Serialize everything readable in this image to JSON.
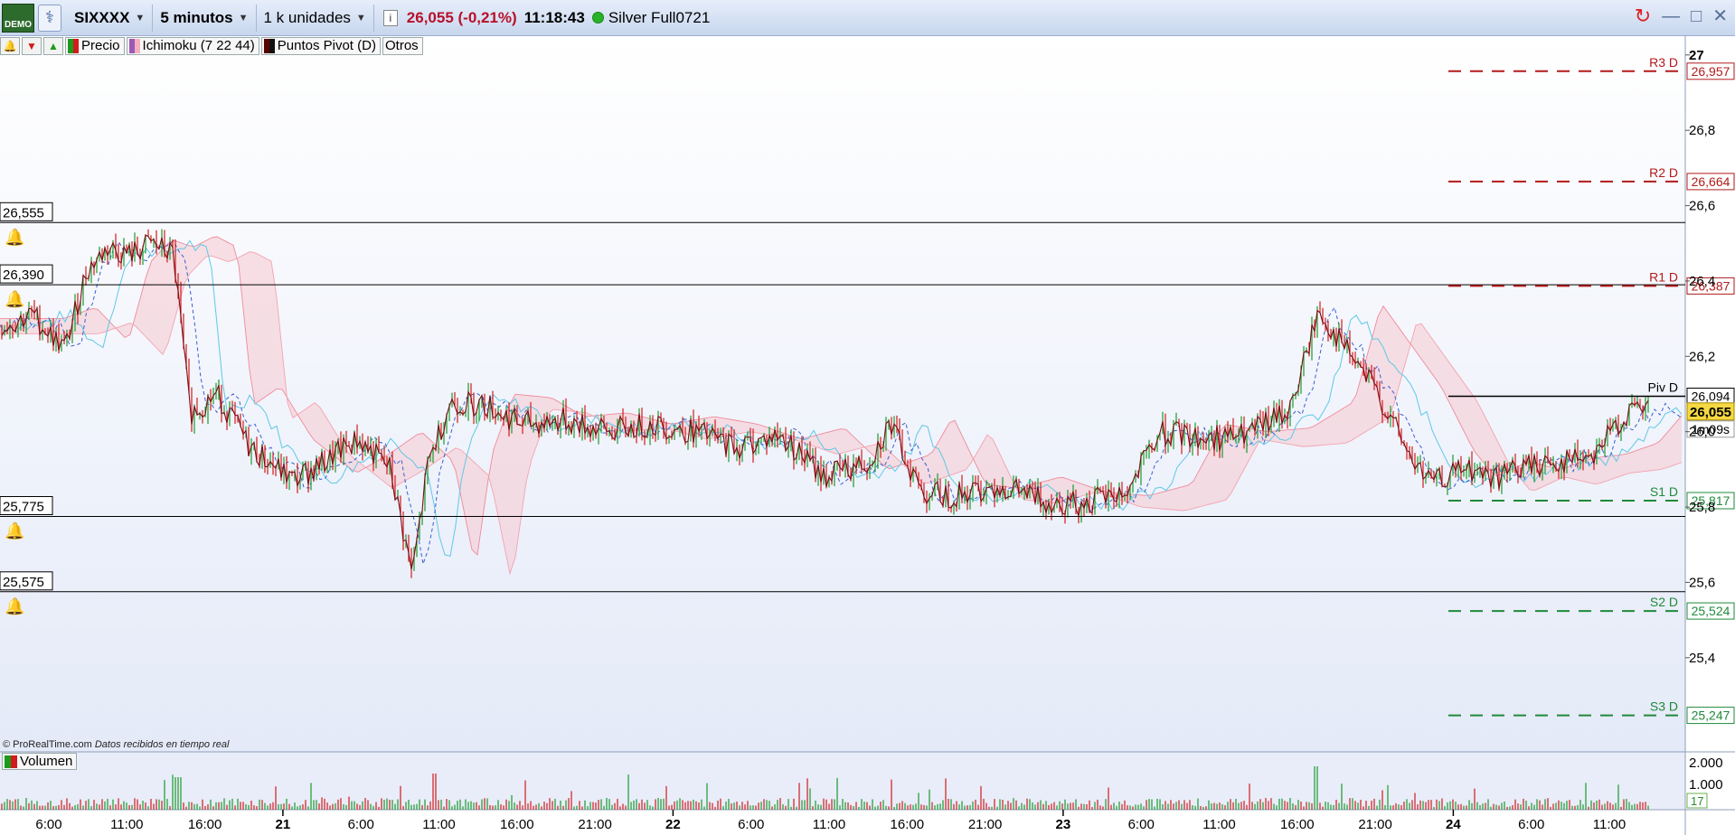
{
  "toolbar": {
    "demo_label": "DEMO",
    "ticker": "SIXXXX",
    "timeframe": "5 minutos",
    "units": "1 k unidades",
    "info_icon": "i",
    "last_price": "26,055 (-0,21%)",
    "time": "11:18:43",
    "account": "Silver Full0721"
  },
  "legend": {
    "items": [
      "Precio",
      "Ichimoku (7 22 44)",
      "Puntos Pivot (D)",
      "Otros"
    ]
  },
  "copyright": {
    "brand": "© ProRealTime.com",
    "note": "Datos recibidos en tiempo real"
  },
  "volume": {
    "label": "Volumen"
  },
  "chart_data": {
    "type": "line",
    "y_axis_ticks": [
      "27",
      "26,8",
      "26,6",
      "26,4",
      "26,2",
      "26,0",
      "25,8",
      "25,6",
      "25,4"
    ],
    "x_axis_ticks": [
      "6:00",
      "11:00",
      "16:00",
      "21",
      "6:00",
      "11:00",
      "16:00",
      "21:00",
      "22",
      "6:00",
      "11:00",
      "16:00",
      "21:00",
      "23",
      "6:00",
      "11:00",
      "16:00",
      "21:00",
      "24",
      "6:00",
      "11:00"
    ],
    "ylim": [
      25.15,
      27.05
    ],
    "pivots": [
      {
        "name": "R3 D",
        "value": 26.957,
        "label": "26,957",
        "color": "#b31a1a"
      },
      {
        "name": "R2 D",
        "value": 26.664,
        "label": "26,664",
        "color": "#b31a1a"
      },
      {
        "name": "R1 D",
        "value": 26.387,
        "label": "26,387",
        "color": "#b31a1a"
      },
      {
        "name": "Piv D",
        "value": 26.094,
        "label": "26,094",
        "color": "#000000"
      },
      {
        "name": "S1 D",
        "value": 25.817,
        "label": "25,817",
        "color": "#1f8a3a"
      },
      {
        "name": "S2 D",
        "value": 25.524,
        "label": "25,524",
        "color": "#1f8a3a"
      },
      {
        "name": "S3 D",
        "value": 25.247,
        "label": "25,247",
        "color": "#1f8a3a"
      }
    ],
    "alert_lines": [
      {
        "value": 26.555,
        "label": "26,555"
      },
      {
        "value": 26.39,
        "label": "26,390"
      },
      {
        "value": 25.775,
        "label": "25,775"
      },
      {
        "value": 25.575,
        "label": "25,575"
      }
    ],
    "current_price": {
      "value": 26.055,
      "label": "26,055",
      "countdown": "1m09s"
    },
    "price_path": [
      [
        0,
        26.28
      ],
      [
        30,
        26.31
      ],
      [
        60,
        26.22
      ],
      [
        80,
        26.43
      ],
      [
        100,
        26.49
      ],
      [
        120,
        26.47
      ],
      [
        140,
        26.5
      ],
      [
        160,
        26.47
      ],
      [
        175,
        26.05
      ],
      [
        200,
        26.1
      ],
      [
        230,
        25.96
      ],
      [
        270,
        25.87
      ],
      [
        300,
        25.92
      ],
      [
        330,
        25.98
      ],
      [
        360,
        25.9
      ],
      [
        380,
        25.62
      ],
      [
        395,
        25.92
      ],
      [
        415,
        26.08
      ],
      [
        450,
        26.07
      ],
      [
        480,
        26.02
      ],
      [
        520,
        26.03
      ],
      [
        560,
        26.0
      ],
      [
        600,
        26.02
      ],
      [
        640,
        26.0
      ],
      [
        680,
        25.96
      ],
      [
        720,
        25.99
      ],
      [
        760,
        25.88
      ],
      [
        800,
        25.92
      ],
      [
        820,
        26.02
      ],
      [
        850,
        25.84
      ],
      [
        880,
        25.83
      ],
      [
        920,
        25.86
      ],
      [
        960,
        25.82
      ],
      [
        1000,
        25.81
      ],
      [
        1040,
        25.84
      ],
      [
        1070,
        26.0
      ],
      [
        1110,
        25.98
      ],
      [
        1150,
        25.99
      ],
      [
        1190,
        26.06
      ],
      [
        1215,
        26.32
      ],
      [
        1240,
        26.22
      ],
      [
        1270,
        26.1
      ],
      [
        1300,
        25.93
      ],
      [
        1320,
        25.86
      ],
      [
        1350,
        25.9
      ],
      [
        1380,
        25.88
      ],
      [
        1410,
        25.91
      ],
      [
        1440,
        25.92
      ],
      [
        1470,
        25.95
      ],
      [
        1500,
        26.05
      ],
      [
        1520,
        26.055
      ]
    ],
    "volume_ticks": [
      "2.000",
      "1.000"
    ],
    "volume_box_label": "17"
  }
}
